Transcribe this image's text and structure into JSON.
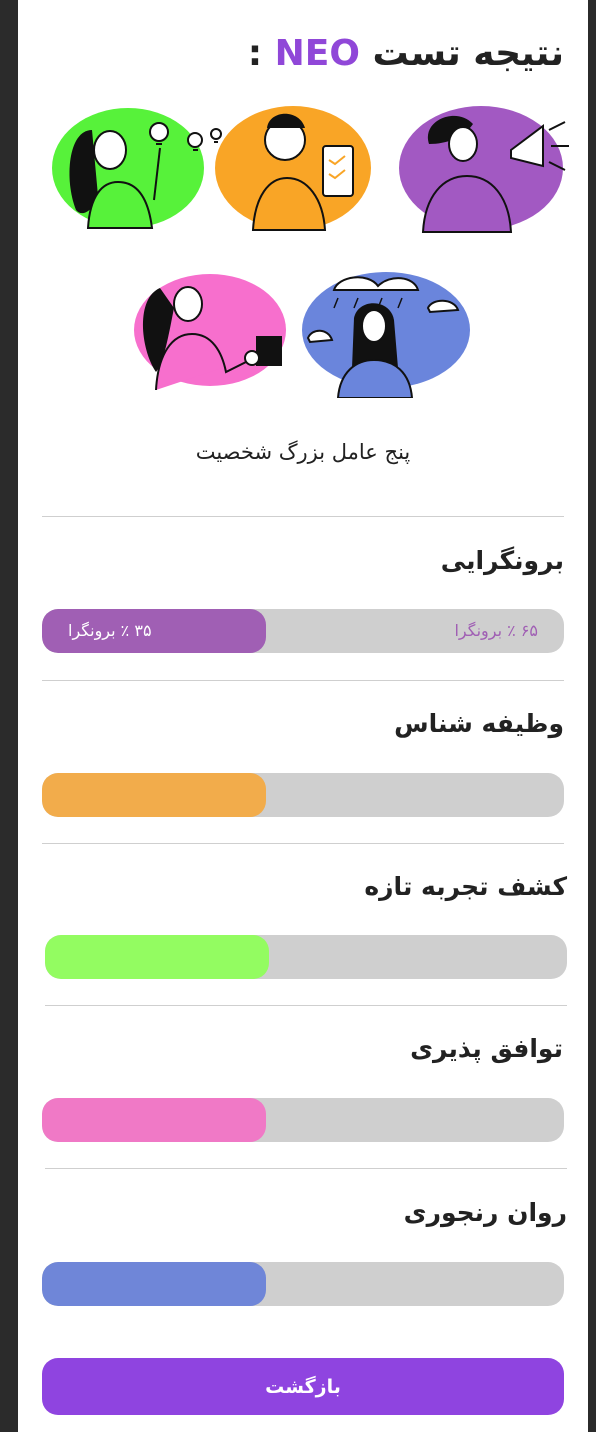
{
  "header": {
    "title_prefix": "نتیجه تست",
    "title_highlight": "NEO",
    "title_suffix": ":"
  },
  "subtitle": "پنج عامل بزرگ شخصیت",
  "traits": [
    {
      "title": "برونگرایی",
      "fill_fraction": 0.43,
      "color": "#a05fb4",
      "left_label": "۳۵ ٪ برونگرا",
      "right_label": "۶۵ ٪ برونگرا"
    },
    {
      "title": "وظیفه شناس",
      "fill_fraction": 0.43,
      "color": "#f2ac4b"
    },
    {
      "title": "کشف تجربه تازه",
      "fill_fraction": 0.43,
      "color": "#93fc61"
    },
    {
      "title": "توافق پذیری",
      "fill_fraction": 0.43,
      "color": "#f079c6"
    },
    {
      "title": "روان رنجوری",
      "fill_fraction": 0.43,
      "color": "#6f86d8"
    }
  ],
  "back_label": "بازگشت",
  "colors": {
    "accent": "#9047d8",
    "track": "#cfcfcf"
  }
}
